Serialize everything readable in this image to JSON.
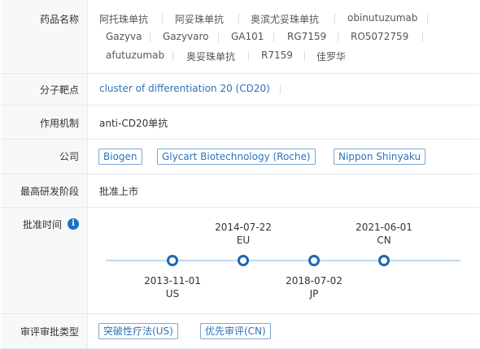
{
  "drug_names": {
    "label": "药品名称",
    "items": [
      "阿托珠单抗",
      "阿妥珠单抗",
      "奥滨尤妥珠单抗",
      "obinutuzumab",
      "Gazyva",
      "Gazyvaro",
      "GA101",
      "RG7159",
      "RO5072759",
      "afutuzumab",
      "奥妥珠单抗",
      "R7159",
      "佳罗华"
    ]
  },
  "target": {
    "label": "分子靶点",
    "value": "cluster of differentiation 20 (CD20)"
  },
  "mechanism": {
    "label": "作用机制",
    "value": "anti-CD20单抗"
  },
  "company": {
    "label": "公司",
    "items": [
      "Biogen",
      "Glycart Biotechnology (Roche)",
      "Nippon Shinyaku"
    ]
  },
  "highest_phase": {
    "label": "最高研发阶段",
    "value": "批准上市"
  },
  "approval": {
    "label": "批准时间",
    "info_icon": "info-icon",
    "events": [
      {
        "date": "2013-11-01",
        "region": "US"
      },
      {
        "date": "2014-07-22",
        "region": "EU"
      },
      {
        "date": "2018-07-02",
        "region": "JP"
      },
      {
        "date": "2021-06-01",
        "region": "CN"
      }
    ]
  },
  "review_type": {
    "label": "审评审批类型",
    "items": [
      "突破性疗法(US)",
      "优先审评(CN)"
    ]
  },
  "colors": {
    "accent": "#1d66b3",
    "link": "#2e72b8",
    "label_bg": "#f7f8fa",
    "border": "#e6e9ee"
  }
}
